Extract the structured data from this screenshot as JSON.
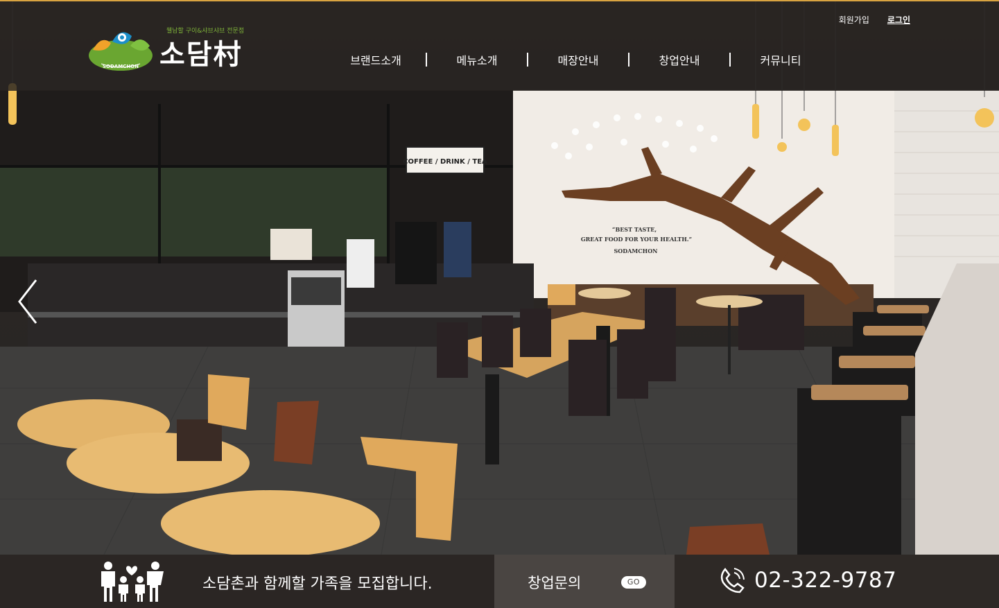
{
  "header": {
    "logo": {
      "tagline": "웰남할 구이&샤브샤브 전문점",
      "name": "소담村",
      "badge_text": "SODAMCHON"
    },
    "util_links": [
      "회원가입",
      "로그인"
    ],
    "nav": [
      "브랜드소개",
      "메뉴소개",
      "매장안내",
      "창업안내",
      "커뮤니티"
    ]
  },
  "hero": {
    "signage": {
      "menu_board": "COFFEE / DRINK / TEA",
      "wall_quote_line1": "“BEST TASTE,",
      "wall_quote_line2": "GREAT FOOD FOR YOUR HEALTH.”",
      "wall_quote_line3": "SODAMCHON"
    },
    "prev_icon": "chevron-left-icon"
  },
  "bottom_bar": {
    "recruit_text": "소담촌과 함께할 가족을 모집합니다.",
    "inquiry_label": "창업문의",
    "go_label": "GO",
    "phone": "02-322-9787",
    "family_icon": "family-icon",
    "phone_icon": "phone-icon"
  },
  "colors": {
    "header_bg": "#262220",
    "accent_line": "#d9a441",
    "inquiry_bg": "#4a4542",
    "bottom_bg": "#2e2926",
    "logo_green": "#7fb33a"
  }
}
